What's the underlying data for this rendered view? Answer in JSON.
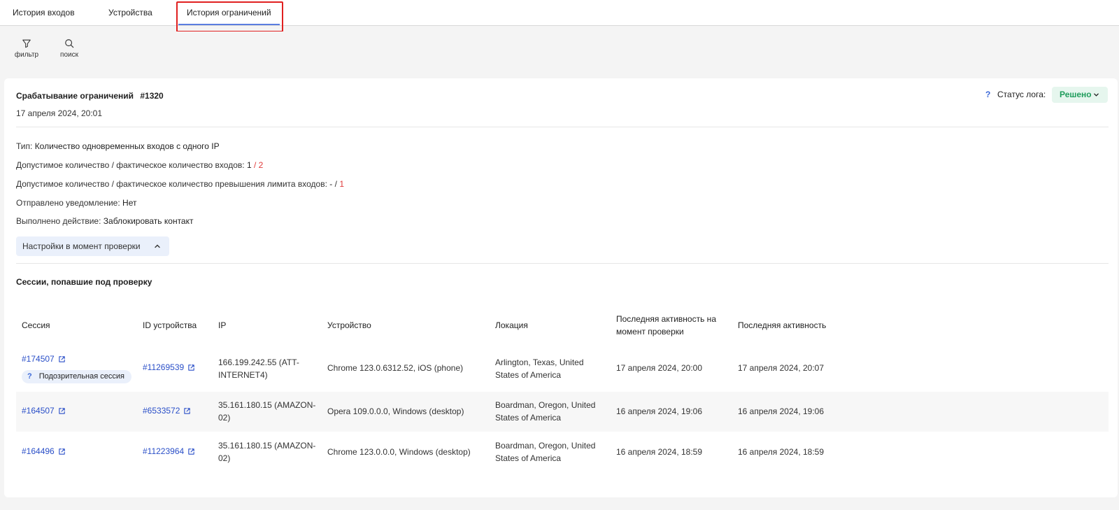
{
  "tabs": [
    {
      "label": "История входов"
    },
    {
      "label": "Устройства"
    },
    {
      "label": "История ограничений",
      "active": true
    }
  ],
  "toolbar": {
    "filter_label": "фильтр",
    "search_label": "поиск"
  },
  "log": {
    "title": "Срабатывание ограничений",
    "id": "#1320",
    "date": "17 апреля 2024, 20:01",
    "status_help": "?",
    "status_label": "Статус лога:",
    "status_value": "Решено",
    "type_label": "Тип:",
    "type_value": "Количество одновременных входов с одного IP",
    "logins_label": "Допустимое количество / фактическое количество входов:",
    "logins_allowed": "1",
    "logins_sep": "/",
    "logins_actual": "2",
    "limit_label": "Допустимое количество / фактическое количество превышения лимита входов:",
    "limit_allowed": "-",
    "limit_sep": "/",
    "limit_actual": "1",
    "notify_label": "Отправлено уведомление:",
    "notify_value": "Нет",
    "action_label": "Выполнено действие:",
    "action_value": "Заблокировать контакт",
    "settings_button": "Настройки в момент проверки"
  },
  "sessions": {
    "title": "Сессии, попавшие под проверку",
    "columns": {
      "session": "Сессия",
      "device_id": "ID устройства",
      "ip": "IP",
      "device": "Устройство",
      "location": "Локация",
      "last_active_check_1": "Последняя активность на",
      "last_active_check_2": "момент проверки",
      "last_active": "Последняя активность"
    },
    "rows": [
      {
        "session": "#174507",
        "badge_q": "?",
        "badge": "Подозрительная сессия",
        "device_id": "#11269539",
        "ip_1": "166.199.242.55 (ATT-",
        "ip_2": "INTERNET4)",
        "device": "Chrome 123.0.6312.52, iOS (phone)",
        "location_1": "Arlington, Texas, United",
        "location_2": "States of America",
        "last_active_check": "17 апреля 2024, 20:00",
        "last_active": "17 апреля 2024, 20:07"
      },
      {
        "session": "#164507",
        "device_id": "#6533572",
        "ip_1": "35.161.180.15 (AMAZON-",
        "ip_2": "02)",
        "device": "Opera 109.0.0.0, Windows (desktop)",
        "location_1": "Boardman, Oregon, United",
        "location_2": "States of America",
        "last_active_check": "16 апреля 2024, 19:06",
        "last_active": "16 апреля 2024, 19:06"
      },
      {
        "session": "#164496",
        "device_id": "#11223964",
        "ip_1": "35.161.180.15 (AMAZON-",
        "ip_2": "02)",
        "device": "Chrome 123.0.0.0, Windows (desktop)",
        "location_1": "Boardman, Oregon, United",
        "location_2": "States of America",
        "last_active_check": "16 апреля 2024, 18:59",
        "last_active": "16 апреля 2024, 18:59"
      }
    ]
  },
  "colors": {
    "accent": "#5b7ee0",
    "link": "#2a4fc8",
    "danger": "#e03a3a",
    "success": "#1f9d5c"
  }
}
